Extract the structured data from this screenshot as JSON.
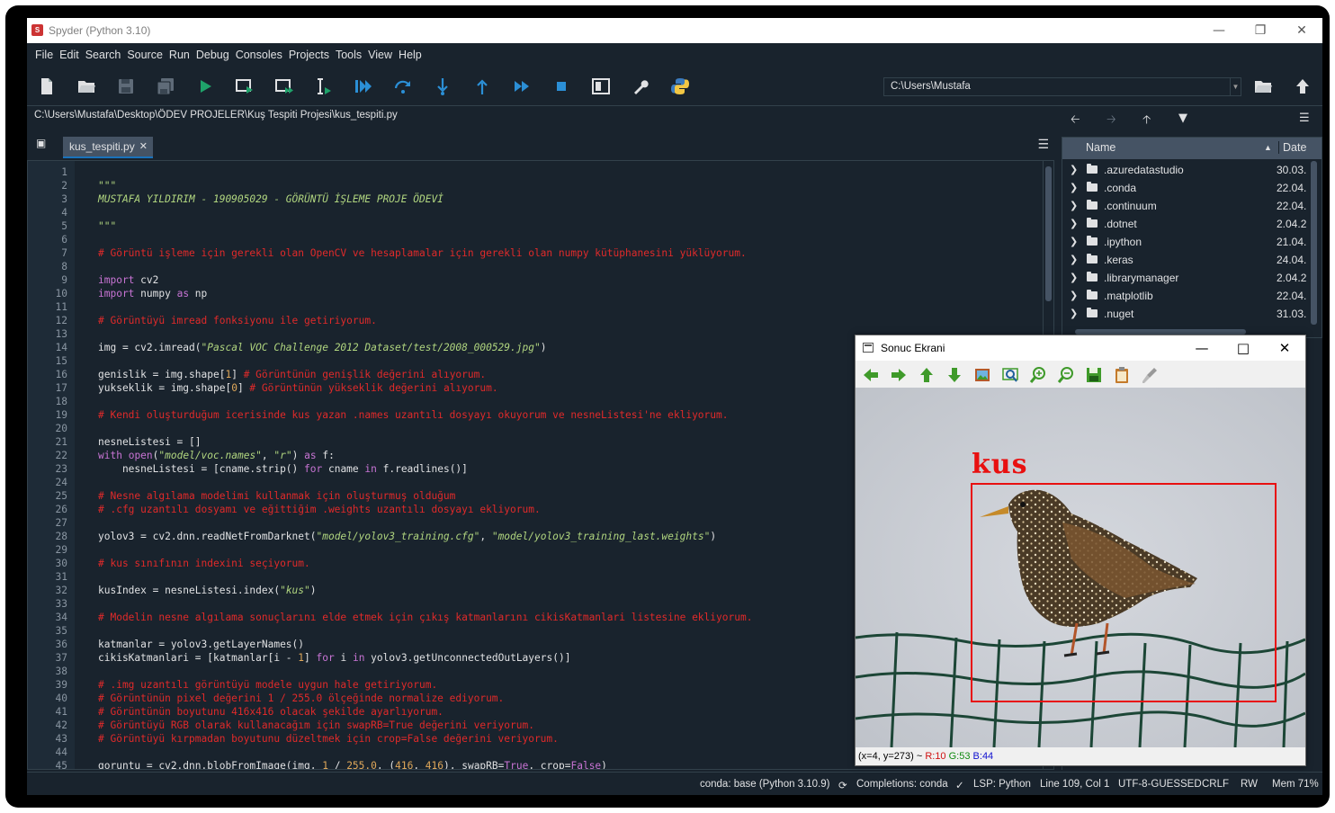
{
  "window": {
    "title": "Spyder (Python 3.10)"
  },
  "menu": [
    "File",
    "Edit",
    "Search",
    "Source",
    "Run",
    "Debug",
    "Consoles",
    "Projects",
    "Tools",
    "View",
    "Help"
  ],
  "toolbar": {
    "icons": [
      "new-file-icon",
      "open-file-icon",
      "save-icon",
      "save-all-icon",
      "run-icon",
      "run-cell-icon",
      "run-cell-advance-icon",
      "run-selection-icon",
      "debug-icon",
      "step-icon",
      "step-into-icon",
      "step-return-icon",
      "continue-icon",
      "stop-icon",
      "maximize-pane-icon",
      "preferences-icon",
      "python-path-icon"
    ],
    "working_dir": "C:\\Users\\Mustafa"
  },
  "editor": {
    "file_path": "C:\\Users\\Mustafa\\Desktop\\ÖDEV PROJELER\\Kuş Tespiti Projesi\\kus_tespiti.py",
    "tab": "kus_tespiti.py",
    "lines": [
      [],
      [
        [
          "d",
          "\"\"\""
        ]
      ],
      [
        [
          "d",
          "MUSTAFA YILDIRIM - 190905029 - GÖRÜNTÜ İŞLEME PROJE ÖDEVİ"
        ]
      ],
      [],
      [
        [
          "d",
          "\"\"\""
        ]
      ],
      [],
      [
        [
          "c",
          "# Görüntü işleme için gerekli olan OpenCV ve hesaplamalar için gerekli olan numpy kütüphanesini yüklüyorum."
        ]
      ],
      [],
      [
        [
          "k",
          "import"
        ],
        [
          "t",
          " cv2"
        ]
      ],
      [
        [
          "k",
          "import"
        ],
        [
          "t",
          " numpy "
        ],
        [
          "k",
          "as"
        ],
        [
          "t",
          " np"
        ]
      ],
      [],
      [
        [
          "c",
          "# Görüntüyü imread fonksiyonu ile getiriyorum."
        ]
      ],
      [],
      [
        [
          "t",
          "img = cv2.imread("
        ],
        [
          "s",
          "\"Pascal VOC Challenge 2012 Dataset/test/2008_000529.jpg\""
        ],
        [
          "t",
          ")"
        ]
      ],
      [],
      [
        [
          "t",
          "genislik = img.shape["
        ],
        [
          "n",
          "1"
        ],
        [
          "t",
          "] "
        ],
        [
          "c",
          "# Görüntünün genişlik değerini alıyorum."
        ]
      ],
      [
        [
          "t",
          "yukseklik = img.shape["
        ],
        [
          "n",
          "0"
        ],
        [
          "t",
          "] "
        ],
        [
          "c",
          "# Görüntünün yükseklik değerini alıyorum."
        ]
      ],
      [],
      [
        [
          "c",
          "# Kendi oluşturduğum icerisinde kus yazan .names uzantılı dosyayı okuyorum ve nesneListesi'ne ekliyorum."
        ]
      ],
      [],
      [
        [
          "t",
          "nesneListesi = []"
        ]
      ],
      [
        [
          "k",
          "with"
        ],
        [
          "t",
          " "
        ],
        [
          "k",
          "open"
        ],
        [
          "t",
          "("
        ],
        [
          "s",
          "\"model/voc.names\""
        ],
        [
          "t",
          ", "
        ],
        [
          "s",
          "\"r\""
        ],
        [
          "t",
          ") "
        ],
        [
          "k",
          "as"
        ],
        [
          "t",
          " f:"
        ]
      ],
      [
        [
          "t",
          "    nesneListesi = [cname.strip() "
        ],
        [
          "k",
          "for"
        ],
        [
          "t",
          " cname "
        ],
        [
          "k",
          "in"
        ],
        [
          "t",
          " f.readlines()]"
        ]
      ],
      [],
      [
        [
          "c",
          "# Nesne algılama modelimi kullanmak için oluşturmuş olduğum"
        ]
      ],
      [
        [
          "c",
          "# .cfg uzantılı dosyamı ve eğittiğim .weights uzantılı dosyayı ekliyorum."
        ]
      ],
      [],
      [
        [
          "t",
          "yolov3 = cv2.dnn.readNetFromDarknet("
        ],
        [
          "s",
          "\"model/yolov3_training.cfg\""
        ],
        [
          "t",
          ", "
        ],
        [
          "s",
          "\"model/yolov3_training_last.weights\""
        ],
        [
          "t",
          ")"
        ]
      ],
      [],
      [
        [
          "c",
          "# kus sınıfının indexini seçiyorum."
        ]
      ],
      [],
      [
        [
          "t",
          "kusIndex = nesneListesi.index("
        ],
        [
          "s",
          "\"kus\""
        ],
        [
          "t",
          ")"
        ]
      ],
      [],
      [
        [
          "c",
          "# Modelin nesne algılama sonuçlarını elde etmek için çıkış katmanlarını cikisKatmanlari listesine ekliyorum."
        ]
      ],
      [],
      [
        [
          "t",
          "katmanlar = yolov3.getLayerNames()"
        ]
      ],
      [
        [
          "t",
          "cikisKatmanlari = [katmanlar[i - "
        ],
        [
          "n",
          "1"
        ],
        [
          "t",
          "] "
        ],
        [
          "k",
          "for"
        ],
        [
          "t",
          " i "
        ],
        [
          "k",
          "in"
        ],
        [
          "t",
          " yolov3.getUnconnectedOutLayers()]"
        ]
      ],
      [],
      [
        [
          "c",
          "# .img uzantılı görüntüyü modele uygun hale getiriyorum."
        ]
      ],
      [
        [
          "c",
          "# Görüntünün pixel değerini 1 / 255.0 ölçeğinde normalize ediyorum."
        ]
      ],
      [
        [
          "c",
          "# Görüntünün boyutunu 416x416 olacak şekilde ayarlıyorum."
        ]
      ],
      [
        [
          "c",
          "# Görüntüyü RGB olarak kullanacağım için swapRB=True değerini veriyorum."
        ]
      ],
      [
        [
          "c",
          "# Görüntüyü kırpmadan boyutunu düzeltmek için crop=False değerini veriyorum."
        ]
      ],
      [],
      [
        [
          "t",
          "goruntu = cv2.dnn.blobFromImage(img, "
        ],
        [
          "n",
          "1"
        ],
        [
          "t",
          " / "
        ],
        [
          "n",
          "255.0"
        ],
        [
          "t",
          ", ("
        ],
        [
          "n",
          "416"
        ],
        [
          "t",
          ", "
        ],
        [
          "n",
          "416"
        ],
        [
          "t",
          "), swapRB="
        ],
        [
          "k",
          "True"
        ],
        [
          "t",
          ", crop="
        ],
        [
          "k",
          "False"
        ],
        [
          "t",
          ")"
        ]
      ]
    ]
  },
  "file_explorer": {
    "columns": [
      "Name",
      "Date"
    ],
    "rows": [
      {
        "name": ".azuredatastudio",
        "date": "30.03."
      },
      {
        "name": ".conda",
        "date": "22.04."
      },
      {
        "name": ".continuum",
        "date": "22.04."
      },
      {
        "name": ".dotnet",
        "date": "2.04.2"
      },
      {
        "name": ".ipython",
        "date": "21.04."
      },
      {
        "name": ".keras",
        "date": "24.04."
      },
      {
        "name": ".librarymanager",
        "date": "2.04.2"
      },
      {
        "name": ".matplotlib",
        "date": "22.04."
      },
      {
        "name": ".nuget",
        "date": "31.03."
      }
    ]
  },
  "status": {
    "conda": "conda: base (Python 3.10.9)",
    "completions": "Completions: conda",
    "lsp": "LSP: Python",
    "position": "Line 109, Col 1",
    "encoding": "UTF-8-GUESSED",
    "eol": "CRLF",
    "rw": "RW",
    "mem": "Mem 71%"
  },
  "popup": {
    "title": "Sonuc Ekrani",
    "detection_label": "kus",
    "box_color": "#e81010",
    "coords": "(x=4, y=273) ~",
    "r": "R:10",
    "g": "G:53",
    "b": "B:44"
  },
  "colors": {
    "accent": "#1a72bb",
    "comment": "#e02a2a",
    "string": "#b0d57f",
    "keyword": "#c874d4",
    "background": "#19232d"
  }
}
